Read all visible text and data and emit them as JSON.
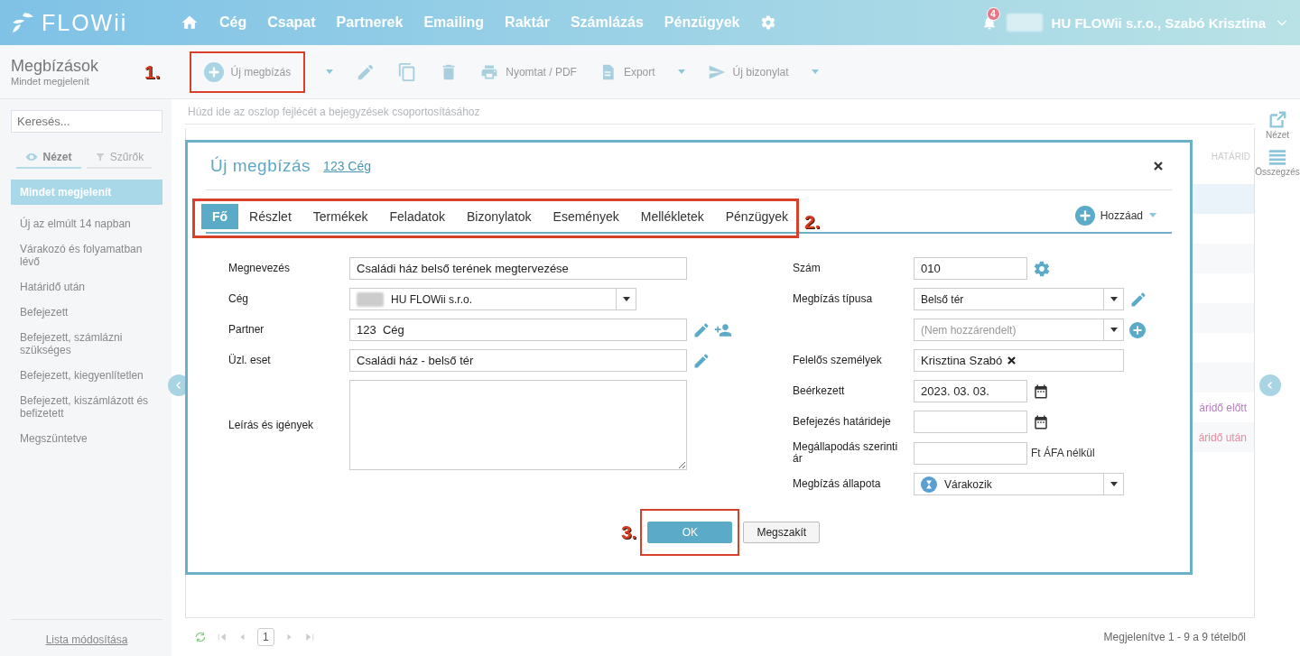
{
  "nav": {
    "logo": "FLOWii",
    "items": [
      "Cég",
      "Csapat",
      "Partnerek",
      "Emailing",
      "Raktár",
      "Számlázás",
      "Pénzügyek"
    ],
    "notifications": "4",
    "account": "HU FLOWii s.r.o., Szabó Krisztina"
  },
  "page": {
    "title": "Megbízások",
    "subtitle": "Mindet megjelenít"
  },
  "toolbar": [
    {
      "kind": "add",
      "label": "Új megbízás",
      "dropdown": true,
      "highlighted": true,
      "callout": "1."
    },
    {
      "kind": "edit"
    },
    {
      "kind": "copy"
    },
    {
      "kind": "delete"
    },
    {
      "kind": "print",
      "label": "Nyomtat / PDF",
      "dropdown": false,
      "highlighted": false
    },
    {
      "kind": "export",
      "label": "Export",
      "dropdown": true,
      "highlighted": false
    },
    {
      "kind": "send",
      "label": "Új bizonylat",
      "dropdown": true,
      "highlighted": false
    }
  ],
  "sidebar": {
    "search": {
      "placeholder": "Keresés..."
    },
    "tabs": [
      {
        "label": "Nézet",
        "kind": "eye",
        "selected": true
      },
      {
        "label": "Szűrők",
        "kind": "filter",
        "selected": false
      }
    ],
    "items": [
      {
        "label": "Mindet megjelenít",
        "selected": true
      },
      {
        "label": "Új az elmúlt 14 napban",
        "selected": false
      },
      {
        "label": "Várakozó és folyamatban lévő",
        "selected": false
      },
      {
        "label": "Határidő után",
        "selected": false
      },
      {
        "label": "Befejezett",
        "selected": false
      },
      {
        "label": "Befejezett, számlázni szükséges",
        "selected": false
      },
      {
        "label": "Befejezett, kiegyenlítetlen",
        "selected": false
      },
      {
        "label": "Befejezett, kiszámlázott és befizetett",
        "selected": false
      },
      {
        "label": "Megszüntetve",
        "selected": false
      }
    ],
    "footer_link": "Lista módosítása"
  },
  "grid": {
    "group_hint": "Húzd ide az oszlop fejlécét a bejegyzések csoportosításához",
    "column_header": "HATÁRID",
    "rows": [
      {
        "selected": true
      },
      {
        "selected": false
      },
      {
        "selected": false
      },
      {
        "selected": false
      },
      {
        "selected": false
      },
      {
        "selected": false
      },
      {
        "selected": false
      },
      {
        "selected": false,
        "status": "áridő előtt",
        "color": "#b97cc4"
      },
      {
        "selected": false,
        "status": "áridő után",
        "color": "#e8899d"
      }
    ],
    "pager": {
      "page": "1",
      "summary": "Megjelenítve 1 - 9 a 9 tételből"
    }
  },
  "right_rail": [
    {
      "kind": "external",
      "label": "Nézet"
    },
    {
      "kind": "list",
      "label": "Összegzés"
    }
  ],
  "dialog": {
    "title": "Új megbízás",
    "subject": "123 Cég",
    "tabs": [
      {
        "label": "Fő",
        "selected": true
      },
      {
        "label": "Részlet",
        "selected": false
      },
      {
        "label": "Termékek",
        "selected": false
      },
      {
        "label": "Feladatok",
        "selected": false
      },
      {
        "label": "Bizonylatok",
        "selected": false
      },
      {
        "label": "Események",
        "selected": false
      },
      {
        "label": "Mellékletek",
        "selected": false
      },
      {
        "label": "Pénzügyek",
        "selected": false
      }
    ],
    "tabs_highlighted": true,
    "tabs_callout": "2.",
    "add_button": "Hozzáad",
    "left_fields": [
      {
        "kind": "text",
        "label": "Megnevezés",
        "value": "Családi ház belső terének megtervezése"
      },
      {
        "kind": "select",
        "label": "Cég",
        "value": "HU FLOWii s.r.o.",
        "redacted": true
      },
      {
        "kind": "text",
        "label": "Partner",
        "value": "123  Cég",
        "actions": [
          {
            "kind": "edit"
          },
          {
            "kind": "add-person"
          }
        ]
      },
      {
        "kind": "text",
        "label": "Üzl. eset",
        "value": "Családi ház - belső tér",
        "actions": [
          {
            "kind": "edit"
          }
        ]
      },
      {
        "kind": "textarea",
        "label": "Leírás és igények"
      }
    ],
    "right_fields": [
      {
        "kind": "short",
        "label": "Szám",
        "value": "010",
        "actions": [
          {
            "kind": "settings"
          }
        ]
      },
      {
        "kind": "select",
        "label": "Megbízás típusa",
        "value": "Belső tér",
        "actions": [
          {
            "kind": "edit"
          }
        ]
      },
      {
        "kind": "select",
        "placeholder": "(Nem hozzárendelt)",
        "actions": [
          {
            "kind": "add"
          }
        ]
      },
      {
        "kind": "tags",
        "label": "Felelős személyek",
        "tags": [
          "Krisztina Szabó"
        ]
      },
      {
        "kind": "date",
        "label": "Beérkezett",
        "value": "2023. 03. 03."
      },
      {
        "kind": "date",
        "label": "Befejezés határideje"
      },
      {
        "kind": "short",
        "label": "Megállapodás szerinti ár",
        "suffix": "Ft ÁFA nélkül"
      },
      {
        "kind": "status",
        "label": "Megbízás állapota",
        "value": "Várakozik"
      }
    ],
    "buttons": [
      {
        "label": "OK",
        "primary": true,
        "highlighted": true,
        "callout": "3."
      },
      {
        "label": "Megszakít",
        "primary": false,
        "highlighted": false
      }
    ]
  }
}
